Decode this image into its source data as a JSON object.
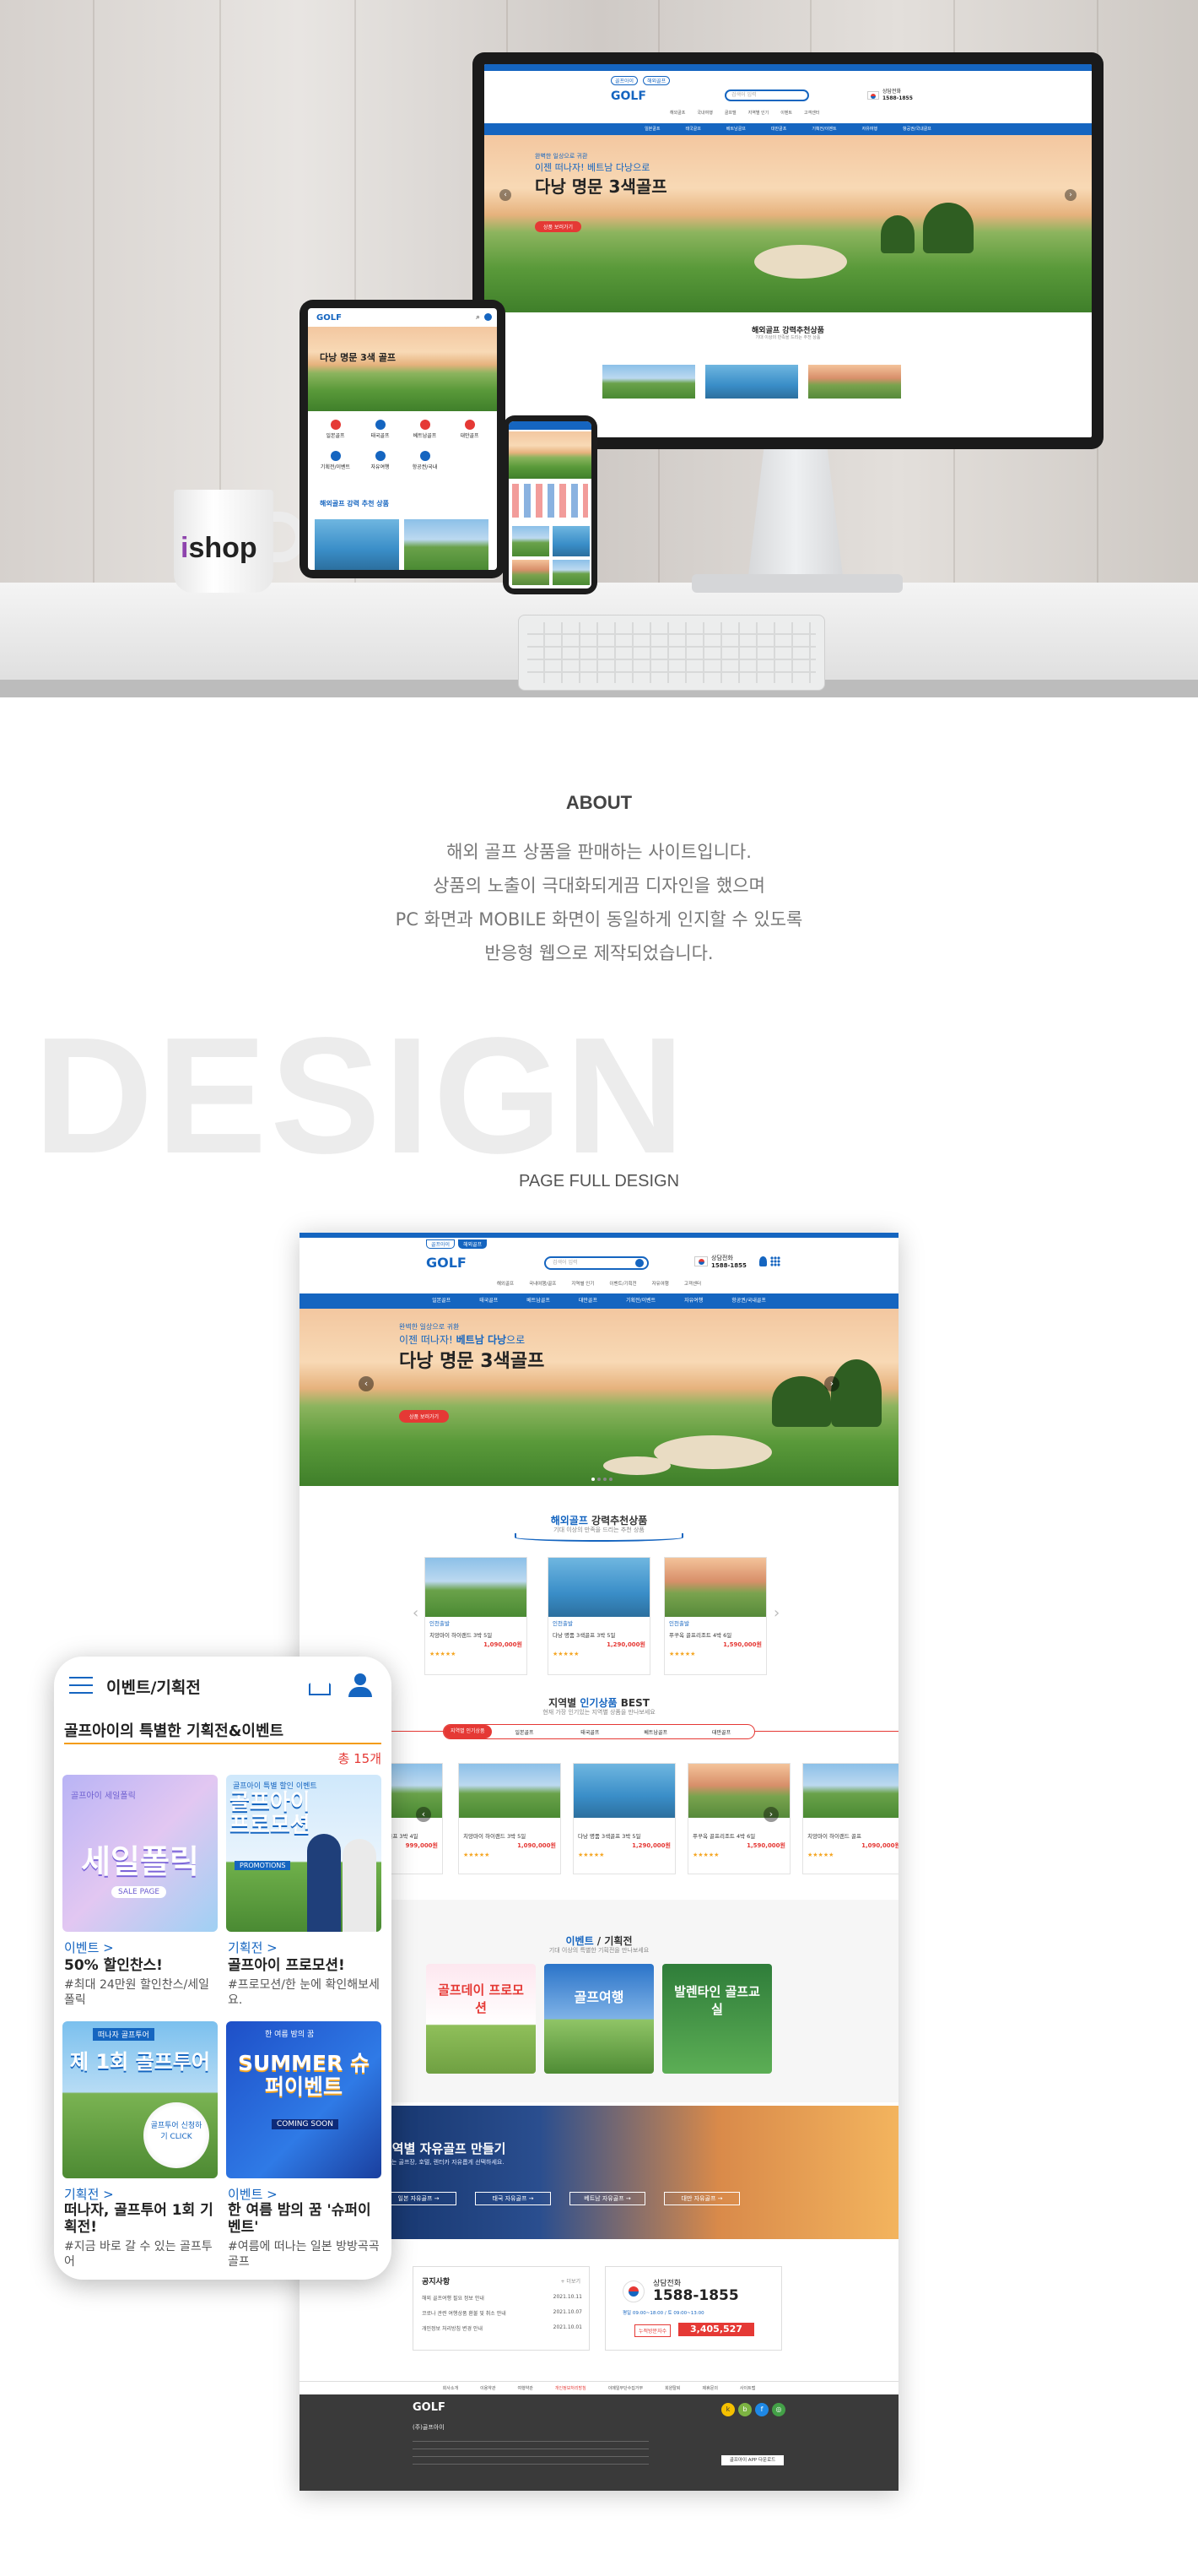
{
  "hero": {
    "mug_brand_i": "i",
    "mug_brand_rest": "shop",
    "monitor": {
      "top_links": [
        "골프아이",
        "해외골프"
      ],
      "logo": "GOLF",
      "search_placeholder": "검색어 입력",
      "phone_label": "상담전화",
      "phone_number": "1588-1855",
      "submenu": [
        "해외골프",
        "국내여행",
        "골프텔",
        "지역별 인기",
        "이벤트",
        "고객센터"
      ],
      "nav": [
        "일본골프",
        "태국골프",
        "베트남골프",
        "대만골프",
        "기획전/이벤트",
        "자유여행",
        "항공권/국내골프"
      ],
      "banner_small": "완벽한 일상으로 귀환",
      "banner_mid": "이젠 떠나자! 베트남 다낭으로",
      "banner_big": "다낭 명문 3색골프",
      "banner_btn": "상품 보러가기",
      "section_title": "해외골프 강력추천상품",
      "section_sub": "기대 이상의 만족을 드리는 추천 상품"
    },
    "tablet": {
      "logo": "GOLF",
      "banner": "다낭 명문 3색 골프",
      "icons": [
        "일본골프",
        "태국골프",
        "베트남골프",
        "대만골프",
        "기획전/이벤트",
        "자유여행",
        "항공권/국내"
      ],
      "section": "해외골프 강력 추천 상품"
    }
  },
  "about": {
    "title": "ABOUT",
    "lines": [
      "해외 골프 상품을 판매하는 사이트입니다.",
      "상품의 노출이 극대화되게끔 디자인을 했으며",
      "PC 화면과 MOBILE 화면이 동일하게 인지할 수 있도록",
      "반응형 웹으로 제작되었습니다."
    ]
  },
  "design": {
    "big_word": "DESIGN",
    "subtitle": "PAGE FULL DESIGN"
  },
  "fullpage": {
    "top_links": [
      "골프아이",
      "해외골프"
    ],
    "logo": "GOLF",
    "search_placeholder": "검색어 입력",
    "phone_label": "상담전화",
    "phone_number": "1588-1855",
    "submenu": [
      "해외골프",
      "국내여행/골프",
      "지역별 인기",
      "이벤트/기획전",
      "자유여행",
      "고객센터"
    ],
    "nav": [
      "일본골프",
      "태국골프",
      "베트남골프",
      "대만골프",
      "기획전/이벤트",
      "자유여행",
      "항공권/국내골프"
    ],
    "banner_small": "완벽한 일상으로 귀환",
    "banner_mid_a": "이젠 떠나자! ",
    "banner_mid_b": "베트남 다낭",
    "banner_mid_c": "으로",
    "banner_big": "다낭 명문 3색골프",
    "banner_btn": "상품 보러가기",
    "rec_title_a": "해외골프",
    "rec_title_b": " 강력추천상품",
    "rec_sub": "기대 이상의 만족을 드리는 추천 상품",
    "rec_cards": [
      {
        "tag": "인천출발",
        "title": "치앙마이 하이랜드 3박 5일",
        "price": "1,090,000원",
        "img": "g"
      },
      {
        "tag": "인천출발",
        "title": "다낭 명품 3색골프 3박 5일",
        "price": "1,290,000원",
        "img": "s"
      },
      {
        "tag": "인천출발",
        "title": "푸꾸옥 골프리조트 4박 6일",
        "price": "1,590,000원",
        "img": "m"
      }
    ],
    "best_title_a": "지역별 ",
    "best_title_b": "인기상품",
    "best_title_c": " BEST",
    "best_sub": "현재 가장 인기있는 지역별 상품을 만나보세요",
    "best_tabs": [
      "지역별 인기상품",
      "일본골프",
      "태국골프",
      "베트남골프",
      "대만골프"
    ],
    "best_cards": [
      {
        "title": "치앙마이 VIP 골프 3박 4일",
        "price": "999,000원",
        "img": "g"
      },
      {
        "title": "치앙마이 하이랜드 3박 5일",
        "price": "1,090,000원",
        "img": "g"
      },
      {
        "title": "다낭 명품 3색골프 3박 5일",
        "price": "1,290,000원",
        "img": "s"
      },
      {
        "title": "푸꾸옥 골프리조트 4박 6일",
        "price": "1,590,000원",
        "img": "m"
      },
      {
        "title": "치앙마이 하이랜드 골프",
        "price": "1,090,000원",
        "img": "g"
      }
    ],
    "event_title_a": "이벤트",
    "event_title_b": " / 기획전",
    "event_sub": "기대 이상의 특별한 기획전을 만나보세요",
    "event_banners": [
      "골프데이 프로모션",
      "골프여행",
      "발렌타인 골프교실"
    ],
    "free_title": "지역별 자유골프 만들기",
    "free_sub": "원하는 골프장, 호텔, 렌터카 자유롭게 선택하세요.",
    "free_btns": [
      "일본 자유골프 →",
      "태국 자유골프 →",
      "베트남 자유골프 →",
      "대만 자유골프 →"
    ],
    "notice_title": "공지사항",
    "notice_more": "+ 더보기",
    "notices": [
      {
        "text": "해외 골프여행 필요 정보 안내",
        "date": "2021.10.11"
      },
      {
        "text": "코로나 관련 여행상품 환불 및 취소 안내",
        "date": "2021.10.07"
      },
      {
        "text": "개인정보 처리방침 변경 안내",
        "date": "2021.10.01"
      }
    ],
    "cs_label": "상담전화",
    "cs_number": "1588-1855",
    "cs_hours": "평일 09:00~18:00 / 토 09:00~13:00",
    "visitors_label": "누적방문자수",
    "visitors_value": "3,405,527",
    "footer_links": [
      "회사소개",
      "이용약관",
      "여행약관",
      "개인정보처리방침",
      "이메일무단수집거부",
      "회원탈퇴",
      "제휴문의",
      "사이트맵"
    ],
    "footer_logo": "GOLF",
    "footer_company": "(주)골프아이",
    "footer_app_btn": "골프아이 APP 다운로드"
  },
  "mobile": {
    "header_title": "이벤트/기획전",
    "section_title": "골프아이의 특별한 기획전&이벤트",
    "count_prefix": "총 ",
    "count_value": "15개",
    "cards": [
      {
        "tag": "이벤트 >",
        "title": "50% 할인찬스!",
        "desc": "#최대 24만원 할인찬스/세일폴릭",
        "banner": "세일폴릭",
        "banner_sub": "SALE PAGE",
        "banner_top": "골프아이 세일폴릭"
      },
      {
        "tag": "기획전 >",
        "title": "골프아이 프로모션!",
        "desc": "#프로모션/한 눈에 확인해보세요.",
        "banner": "골프아이 프로모션",
        "banner_sub": "PROMOTIONS",
        "banner_top": "골프아이 특별 할인 이벤트"
      },
      {
        "tag": "기획전 >",
        "title": "떠나자, 골프투어 1회 기획전!",
        "desc": "#지금 바로 갈 수 있는 골프투어",
        "banner": "제 1회 골프투어",
        "banner_sub": "골프투어 신청하기 CLICK",
        "banner_top": "떠나자 골프투어"
      },
      {
        "tag": "이벤트 >",
        "title": "한 여름 밤의 꿈 '슈퍼이벤트'",
        "desc": "#여름에 떠나는 일본 방방곡곡 골프",
        "banner": "SUMMER 슈퍼이벤트",
        "banner_sub": "COMING SOON",
        "banner_top": "한 여름 밤의 꿈"
      }
    ]
  },
  "colors": {
    "brand_blue": "#1565c0",
    "accent_red": "#e53935",
    "text_gray": "#777777"
  }
}
